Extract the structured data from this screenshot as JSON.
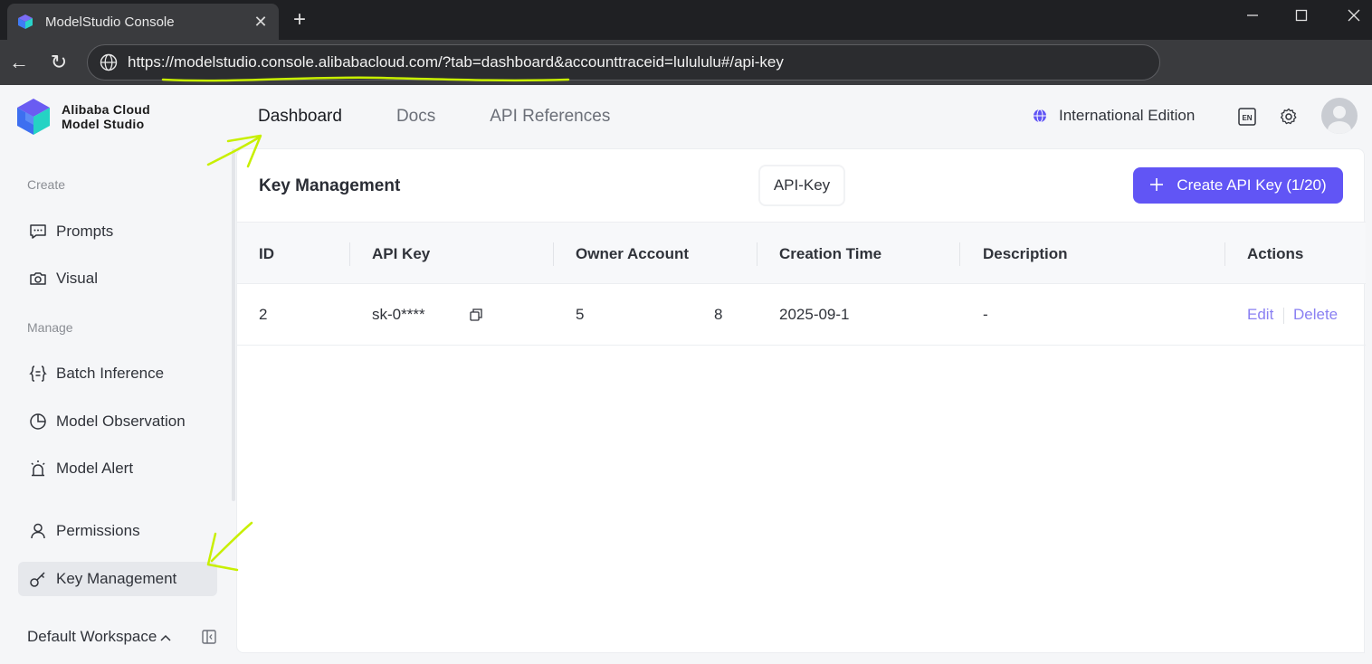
{
  "browser": {
    "tab_title": "ModelStudio Console",
    "tab_close": "✕",
    "new_tab": "+",
    "url_scheme": "https://",
    "url_host": "modelstudio.console.alibabacloud.com",
    "url_rest": "/?tab=dashboard&accounttraceid=lulululu#/api-key",
    "back": "←",
    "reload": "↻"
  },
  "brand": {
    "line1": "Alibaba Cloud",
    "line2": "Model Studio"
  },
  "topnav": {
    "items": [
      {
        "label": "Dashboard",
        "active": true
      },
      {
        "label": "Docs"
      },
      {
        "label": "API References"
      }
    ]
  },
  "header": {
    "edition": "International Edition",
    "lang_icon": "EN"
  },
  "sidebar": {
    "section_create": "Create",
    "section_manage": "Manage",
    "items": [
      {
        "label": "Prompts",
        "icon": "chat-icon"
      },
      {
        "label": "Visual",
        "icon": "camera-icon"
      },
      {
        "label": "Batch Inference",
        "icon": "braces-icon"
      },
      {
        "label": "Model Observation",
        "icon": "pie-chart-icon"
      },
      {
        "label": "Model Alert",
        "icon": "alarm-icon"
      },
      {
        "label": "Permissions",
        "icon": "user-icon"
      },
      {
        "label": "Key Management",
        "icon": "key-icon",
        "active": true
      }
    ],
    "workspace": "Default Workspace"
  },
  "content": {
    "title": "Key Management",
    "pill": "API-Key",
    "create_button": "Create API Key (1/20)",
    "columns": [
      "ID",
      "API Key",
      "Owner Account",
      "Creation Time",
      "Description",
      "Actions"
    ],
    "rows": [
      {
        "id": "2",
        "api_key": "sk-0****",
        "owner_start": "5",
        "owner_end": "8",
        "created": "2025-09-1",
        "description": "-",
        "edit": "Edit",
        "delete": "Delete"
      }
    ]
  },
  "colors": {
    "accent": "#6155f5",
    "link": "#8a80f2",
    "annotation": "#c8ef00"
  }
}
